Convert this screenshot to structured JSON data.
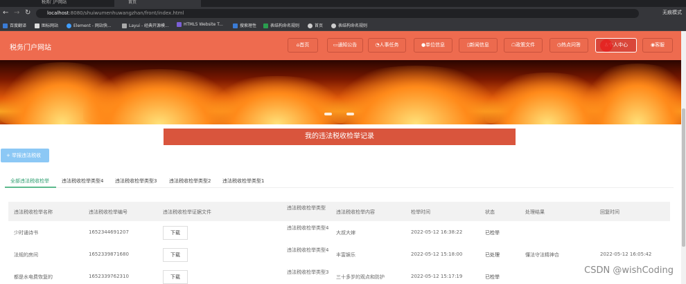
{
  "browser": {
    "tabs": [
      "税务门户网站",
      "首页"
    ],
    "url_host": "localhost",
    "url_rest": ":8080/shuiwumenhuwangzhan/front/index.html",
    "profile": "无痕模式",
    "bookmarks": [
      "百度翻译",
      "图标网站",
      "Element - 网站快...",
      "Layui - 经典开源模...",
      "HTML5 Website T...",
      "搜索理性",
      "表结构命名规则",
      "首页",
      "表结构命名规则"
    ]
  },
  "header": {
    "logo": "税务门户网站",
    "nav": [
      "首页",
      "通知公告",
      "人事任务",
      "单位信息",
      "新闻信息",
      "政策文件",
      "热点问答",
      "个人中心",
      "客服"
    ],
    "nav_icons": [
      "home-icon",
      "notice-icon",
      "task-icon",
      "unit-icon",
      "news-icon",
      "policy-icon",
      "question-icon",
      "user-icon",
      "service-icon"
    ],
    "active_index": 7
  },
  "page": {
    "title": "我的违法税收检举记录",
    "add_button": "+ 举报违法税收",
    "tabs": [
      "全部违法税收检举",
      "违法税收检举类型4",
      "违法税收检举类型3",
      "违法税收检举类型2",
      "违法税收检举类型1"
    ],
    "columns": [
      "违法税收检举名称",
      "违法税收检举编号",
      "违法税收检举证据文件",
      "违法税收检举类型",
      "违法税收检举内容",
      "检举时间",
      "状态",
      "处理结果",
      "回复时间"
    ],
    "download_label": "下载",
    "rows": [
      {
        "name": "少时诵诗书",
        "no": "1652344691207",
        "type": "违法税收检举类型4",
        "content": "大叔大婶",
        "time": "2022-05-12 16:38:22",
        "status": "已检举",
        "result": "",
        "reply": ""
      },
      {
        "name": "法规的房间",
        "no": "1652339871680",
        "type": "违法税收检举类型4",
        "content": "丰富娱乐",
        "time": "2022-05-12 15:18:00",
        "status": "已处理",
        "result": "懂法守法精神合",
        "reply": "2022-05-12 16:05:42"
      },
      {
        "name": "都是水电费恢复的",
        "no": "1652339762310",
        "type": "违法税收检举类型3",
        "content": "三十多岁的观点和防护",
        "time": "2022-05-12 15:17:19",
        "status": "已检举",
        "result": "",
        "reply": ""
      }
    ]
  },
  "watermark": "CSDN @wishCoding"
}
